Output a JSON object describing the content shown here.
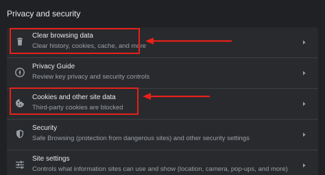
{
  "section_title": "Privacy and security",
  "items": [
    {
      "title": "Clear browsing data",
      "subtitle": "Clear history, cookies, cache, and more",
      "icon": "trash-icon"
    },
    {
      "title": "Privacy Guide",
      "subtitle": "Review key privacy and security controls",
      "icon": "privacy-guide-icon"
    },
    {
      "title": "Cookies and other site data",
      "subtitle": "Third-party cookies are blocked",
      "icon": "cookie-icon"
    },
    {
      "title": "Security",
      "subtitle": "Safe Browsing (protection from dangerous sites) and other security settings",
      "icon": "shield-icon"
    },
    {
      "title": "Site settings",
      "subtitle": "Controls what information sites can use and show (location, camera, pop-ups, and more)",
      "icon": "sliders-icon"
    }
  ],
  "colors": {
    "background": "#202124",
    "card": "#292a2d",
    "text": "#e8eaed",
    "subtext": "#9aa0a6",
    "annotation": "#e8201a"
  }
}
